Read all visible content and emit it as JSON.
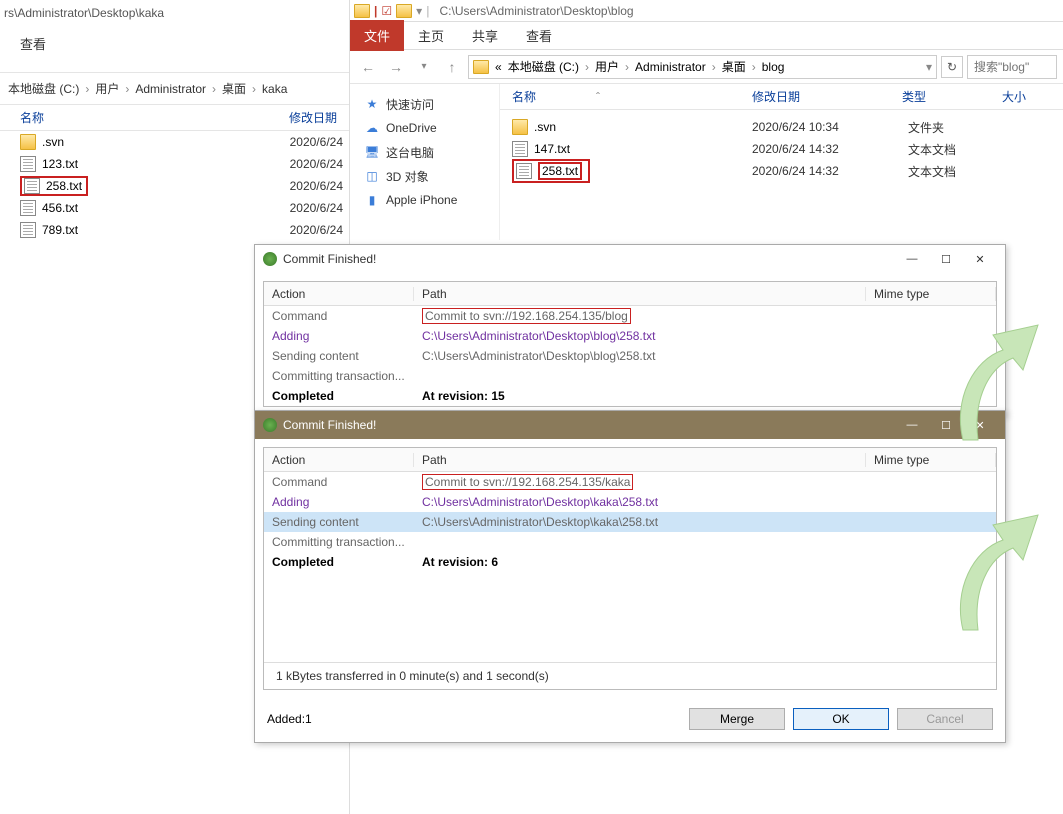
{
  "left_window": {
    "title": "rs\\Administrator\\Desktop\\kaka",
    "tab_view": "查看",
    "breadcrumb": [
      "本地磁盘 (C:)",
      "用户",
      "Administrator",
      "桌面",
      "kaka"
    ],
    "columns": {
      "name": "名称",
      "date": "修改日期"
    },
    "files": [
      {
        "icon": "folder",
        "name": ".svn",
        "date": "2020/6/24",
        "highlight": false
      },
      {
        "icon": "file",
        "name": "123.txt",
        "date": "2020/6/24",
        "highlight": false
      },
      {
        "icon": "file",
        "name": "258.txt",
        "date": "2020/6/24",
        "highlight": true
      },
      {
        "icon": "file",
        "name": "456.txt",
        "date": "2020/6/24",
        "highlight": false
      },
      {
        "icon": "file",
        "name": "789.txt",
        "date": "2020/6/24",
        "highlight": false
      }
    ]
  },
  "right_window": {
    "titlebar_path": "C:\\Users\\Administrator\\Desktop\\blog",
    "ribbon": {
      "file": "文件",
      "home": "主页",
      "share": "共享",
      "view": "查看"
    },
    "breadcrumb_prefix": "«",
    "breadcrumb": [
      "本地磁盘 (C:)",
      "用户",
      "Administrator",
      "桌面",
      "blog"
    ],
    "search_placeholder": "搜索\"blog\"",
    "nav_tree": [
      {
        "icon": "star",
        "label": "快速访问"
      },
      {
        "icon": "cloud",
        "label": "OneDrive"
      },
      {
        "icon": "pc",
        "label": "这台电脑"
      },
      {
        "icon": "cube",
        "label": "3D 对象"
      },
      {
        "icon": "phone",
        "label": "Apple iPhone"
      }
    ],
    "columns": {
      "name": "名称",
      "date": "修改日期",
      "type": "类型",
      "size": "大小"
    },
    "files": [
      {
        "icon": "folder",
        "name": ".svn",
        "date": "2020/6/24 10:34",
        "type": "文件夹",
        "highlight": false
      },
      {
        "icon": "file",
        "name": "147.txt",
        "date": "2020/6/24 14:32",
        "type": "文本文档",
        "highlight": false
      },
      {
        "icon": "file",
        "name": "258.txt",
        "date": "2020/6/24 14:32",
        "type": "文本文档",
        "highlight": true
      }
    ]
  },
  "dialog1": {
    "title": "Commit Finished!",
    "columns": {
      "action": "Action",
      "path": "Path",
      "mime": "Mime type"
    },
    "rows": [
      {
        "action": "Command",
        "path": "Commit to svn://192.168.254.135/blog",
        "cls": "cmd",
        "redbox": true
      },
      {
        "action": "Adding",
        "path": "C:\\Users\\Administrator\\Desktop\\blog\\258.txt",
        "cls": "adding"
      },
      {
        "action": "Sending content",
        "path": "C:\\Users\\Administrator\\Desktop\\blog\\258.txt",
        "cls": "sending"
      },
      {
        "action": "Committing transaction...",
        "path": "",
        "cls": ""
      },
      {
        "action": "Completed",
        "path": "At revision: 15",
        "cls": "done"
      }
    ]
  },
  "dialog2": {
    "title": "Commit Finished!",
    "columns": {
      "action": "Action",
      "path": "Path",
      "mime": "Mime type"
    },
    "rows": [
      {
        "action": "Command",
        "path": "Commit to svn://192.168.254.135/kaka",
        "cls": "cmd",
        "redbox": true
      },
      {
        "action": "Adding",
        "path": "C:\\Users\\Administrator\\Desktop\\kaka\\258.txt",
        "cls": "adding"
      },
      {
        "action": "Sending content",
        "path": "C:\\Users\\Administrator\\Desktop\\kaka\\258.txt",
        "cls": "sending sel"
      },
      {
        "action": "Committing transaction...",
        "path": "",
        "cls": ""
      },
      {
        "action": "Completed",
        "path": "At revision: 6",
        "cls": "done"
      }
    ],
    "status_line": "1 kBytes transferred in 0 minute(s) and 1 second(s)",
    "added_label": "Added:1",
    "buttons": {
      "merge": "Merge",
      "ok": "OK",
      "cancel": "Cancel"
    }
  }
}
